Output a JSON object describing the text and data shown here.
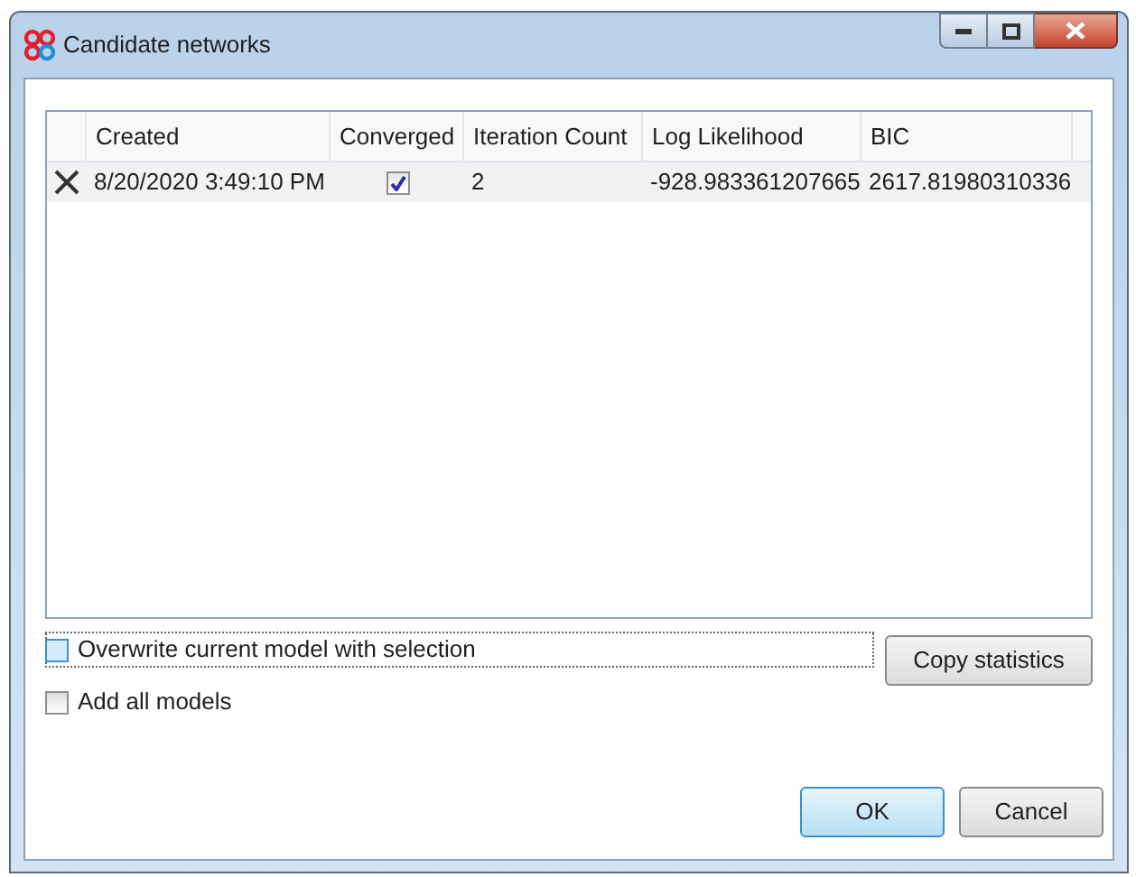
{
  "window": {
    "title": "Candidate networks"
  },
  "table": {
    "columns": [
      "Created",
      "Converged",
      "Iteration Count",
      "Log Likelihood",
      "BIC"
    ],
    "rows": [
      {
        "created": "8/20/2020 3:49:10 PM",
        "converged": true,
        "iteration_count": "2",
        "log_likelihood": "-928.983361207665",
        "bic": "2617.81980310336"
      }
    ]
  },
  "options": [
    {
      "label": "Overwrite current model with selection",
      "checked": false,
      "focused": true
    },
    {
      "label": "Add all models",
      "checked": false,
      "focused": false
    }
  ],
  "buttons": [
    {
      "label": "Copy statistics",
      "kind": "action",
      "default": false
    },
    {
      "label": "OK",
      "kind": "dialog",
      "default": true
    },
    {
      "label": "Cancel",
      "kind": "dialog",
      "default": false
    }
  ]
}
